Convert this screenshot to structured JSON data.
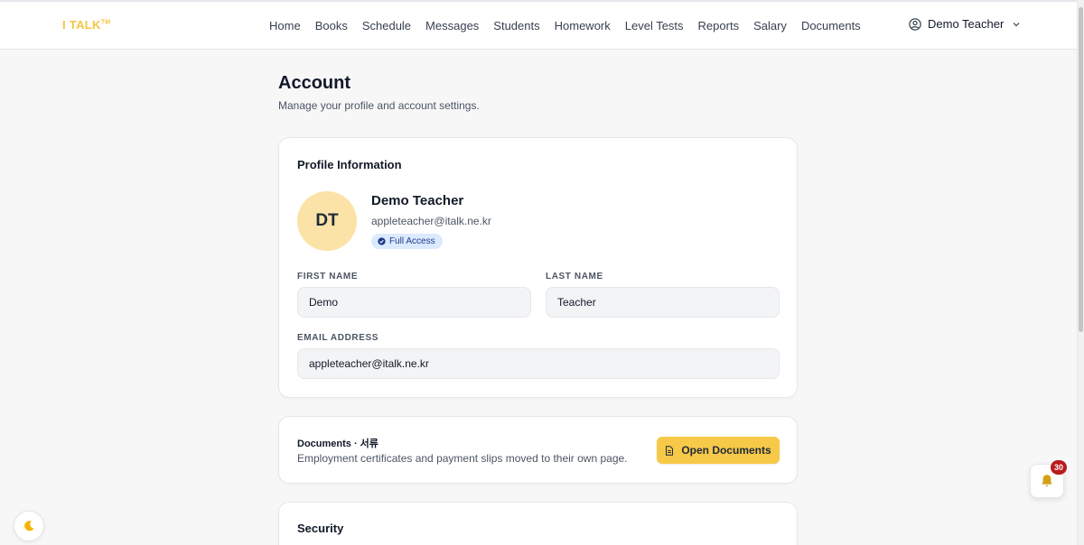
{
  "brand": {
    "logo": "I TALK",
    "trademark": "TM",
    "accent": "#f5c542"
  },
  "nav": {
    "items": [
      "Home",
      "Books",
      "Schedule",
      "Messages",
      "Students",
      "Homework",
      "Level Tests",
      "Reports",
      "Salary",
      "Documents"
    ]
  },
  "user_menu": {
    "name": "Demo Teacher",
    "icon": "user-circle-icon",
    "chevron": "chevron-down-icon"
  },
  "page": {
    "title": "Account",
    "subtitle": "Manage your profile and account settings."
  },
  "profile": {
    "section_title": "Profile Information",
    "initials": "DT",
    "name": "Demo Teacher",
    "email": "appleteacher@italk.ne.kr",
    "badge": "Full Access",
    "badge_icon": "check-circle-icon",
    "first_name_label": "FIRST NAME",
    "first_name_value": "Demo",
    "last_name_label": "LAST NAME",
    "last_name_value": "Teacher",
    "email_label": "EMAIL ADDRESS",
    "email_value": "appleteacher@italk.ne.kr"
  },
  "documents": {
    "title": "Documents · 서류",
    "description": "Employment certificates and payment slips moved to their own page.",
    "button_label": "Open Documents",
    "button_icon": "document-icon",
    "button_color": "#f7c948"
  },
  "security": {
    "title": "Security"
  },
  "floating": {
    "theme_toggle_icon": "moon-icon",
    "notifications_icon": "bell-icon",
    "notifications_count": "30",
    "notifications_badge_color": "#b91c1c"
  }
}
